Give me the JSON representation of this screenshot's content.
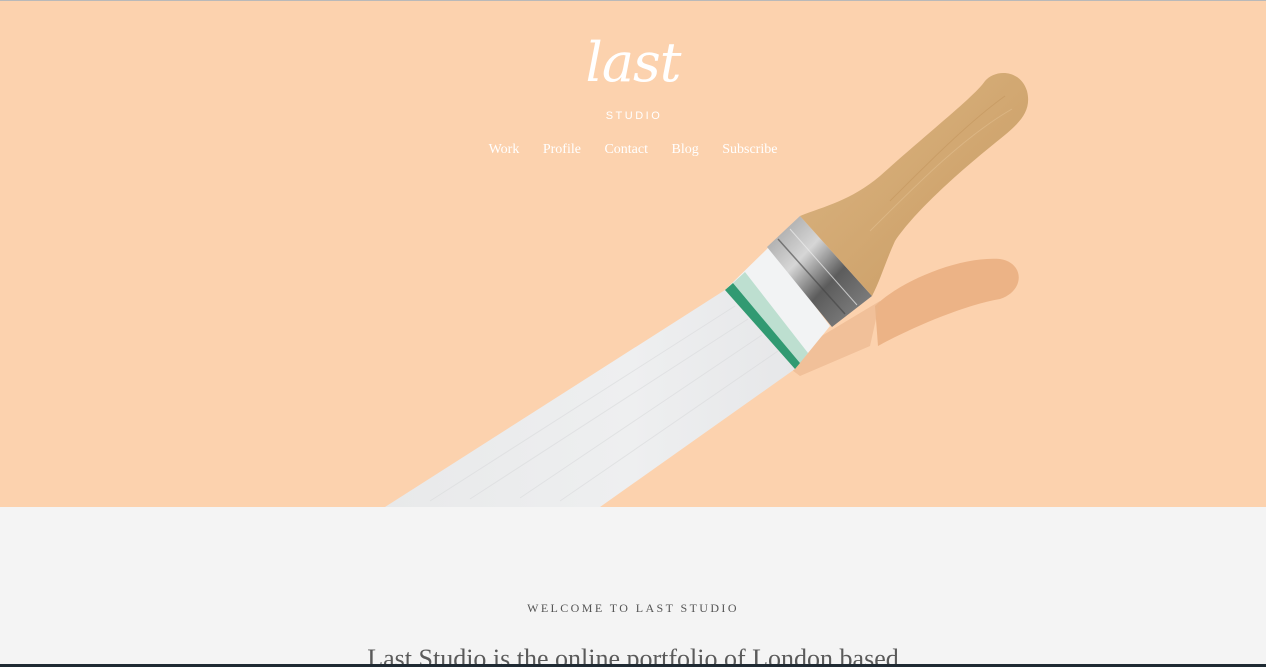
{
  "brand": {
    "logo_script": "last",
    "logo_sub": "STUDIO"
  },
  "nav": {
    "items": [
      {
        "label": "Work"
      },
      {
        "label": "Profile"
      },
      {
        "label": "Contact"
      },
      {
        "label": "Blog"
      },
      {
        "label": "Subscribe"
      }
    ]
  },
  "hero": {
    "background_color": "#fcd2ae",
    "image_subject": "paintbrush-painting-white-stroke"
  },
  "intro": {
    "kicker": "WELCOME TO LAST STUDIO",
    "headline": "Last Studio is the online portfolio of London based"
  },
  "colors": {
    "hero_bg": "#fcd2ae",
    "page_bg": "#f4f4f4",
    "nav_text": "#ffffff",
    "body_text": "#5a5a5a",
    "brush_bristle_tip": "#0f8a5a"
  }
}
